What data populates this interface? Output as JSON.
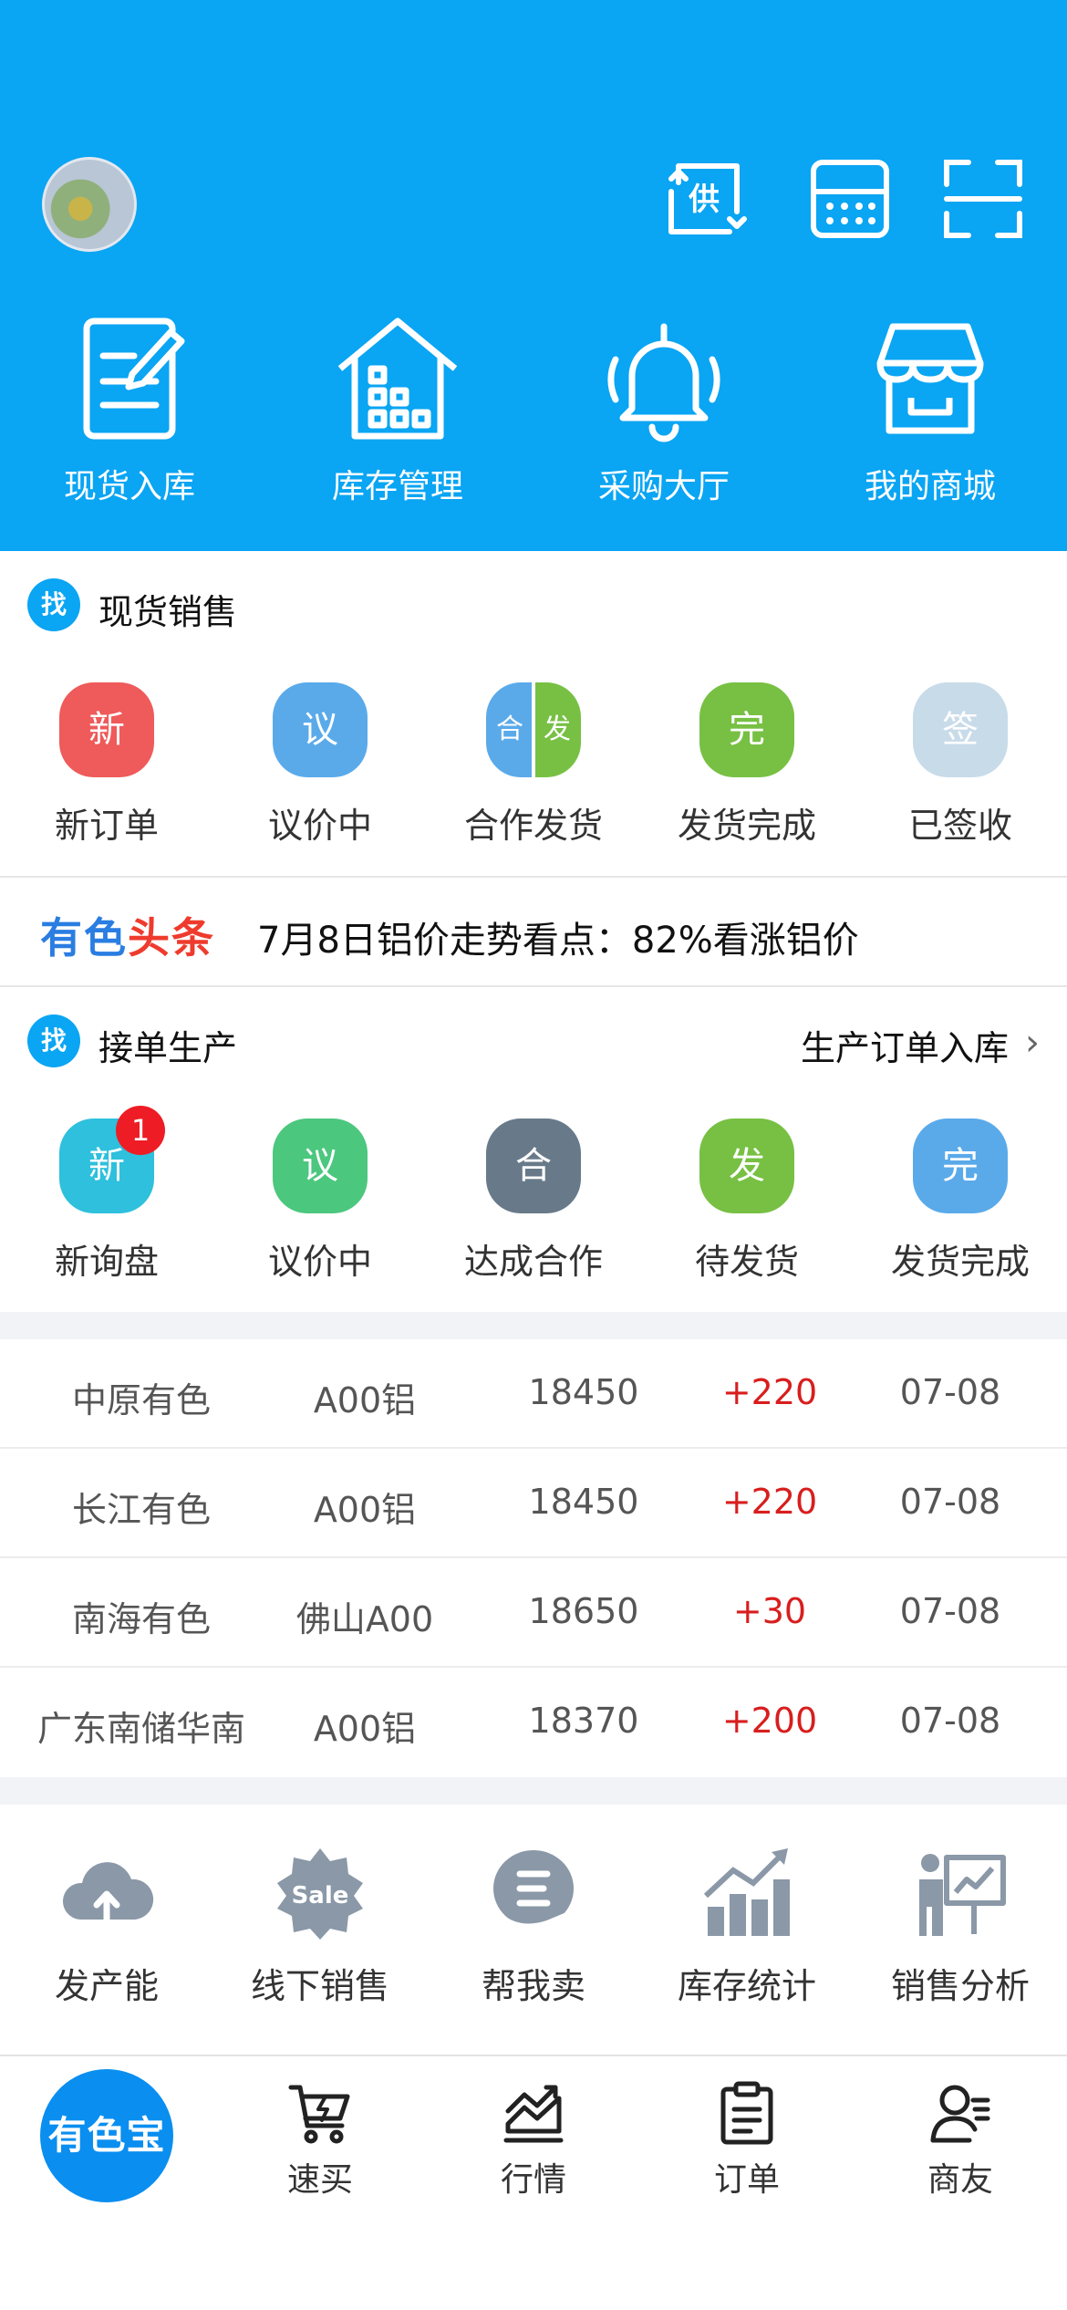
{
  "header": {
    "top_icons": [
      {
        "name": "supply-icon",
        "text": "供"
      },
      {
        "name": "calculator-icon"
      },
      {
        "name": "scan-icon"
      }
    ],
    "nav": [
      {
        "label": "现货入库",
        "icon": "edit-document-icon"
      },
      {
        "label": "库存管理",
        "icon": "warehouse-icon"
      },
      {
        "label": "采购大厅",
        "icon": "bell-icon"
      },
      {
        "label": "我的商城",
        "icon": "shop-icon"
      }
    ]
  },
  "spot_sales": {
    "badge": "找",
    "title": "现货销售",
    "items": [
      {
        "glyph": "新",
        "label": "新订单",
        "color": "#ef5a5a"
      },
      {
        "glyph": "议",
        "label": "议价中",
        "color": "#5aaaea"
      },
      {
        "glyph_left": "合",
        "glyph_right": "发",
        "label": "合作发货"
      },
      {
        "glyph": "完",
        "label": "发货完成",
        "color": "#77c043"
      },
      {
        "glyph": "签",
        "label": "已签收",
        "color": "#c8dbe9"
      }
    ]
  },
  "headline": {
    "logo_a": "有色",
    "logo_b": "头条",
    "text": "7月8日铝价走势看点：82%看涨铝价"
  },
  "production": {
    "badge": "找",
    "title": "接单生产",
    "link": "生产订单入库",
    "items": [
      {
        "glyph": "新",
        "label": "新询盘",
        "color": "#2ec0dc",
        "notify": "1"
      },
      {
        "glyph": "议",
        "label": "议价中",
        "color": "#4cc77e"
      },
      {
        "glyph": "合",
        "label": "达成合作",
        "color": "#687a89"
      },
      {
        "glyph": "发",
        "label": "待发货",
        "color": "#77c043"
      },
      {
        "glyph": "完",
        "label": "发货完成",
        "color": "#5aaaea"
      }
    ]
  },
  "prices": [
    {
      "market": "中原有色",
      "product": "A00铝",
      "price": "18450",
      "change": "+220",
      "date": "07-08"
    },
    {
      "market": "长江有色",
      "product": "A00铝",
      "price": "18450",
      "change": "+220",
      "date": "07-08"
    },
    {
      "market": "南海有色",
      "product": "佛山A00",
      "price": "18650",
      "change": "+30",
      "date": "07-08"
    },
    {
      "market": "广东南储华南",
      "product": "A00铝",
      "price": "18370",
      "change": "+200",
      "date": "07-08"
    }
  ],
  "tools": [
    {
      "label": "发产能",
      "icon": "cloud-upload-icon"
    },
    {
      "label": "线下销售",
      "icon": "sale-badge-icon",
      "icon_text": "Sale"
    },
    {
      "label": "帮我卖",
      "icon": "hand-coin-icon"
    },
    {
      "label": "库存统计",
      "icon": "bar-growth-icon"
    },
    {
      "label": "销售分析",
      "icon": "presentation-icon"
    }
  ],
  "tabbar": {
    "home": "有色宝",
    "tabs": [
      {
        "label": "速买",
        "icon": "cart-bolt-icon"
      },
      {
        "label": "行情",
        "icon": "trend-chart-icon"
      },
      {
        "label": "订单",
        "icon": "clipboard-icon"
      },
      {
        "label": "商友",
        "icon": "contact-icon"
      }
    ]
  },
  "colors": {
    "primary": "#0aa5f3",
    "up": "#d81e1e",
    "home_button": "#0a8ef0"
  }
}
